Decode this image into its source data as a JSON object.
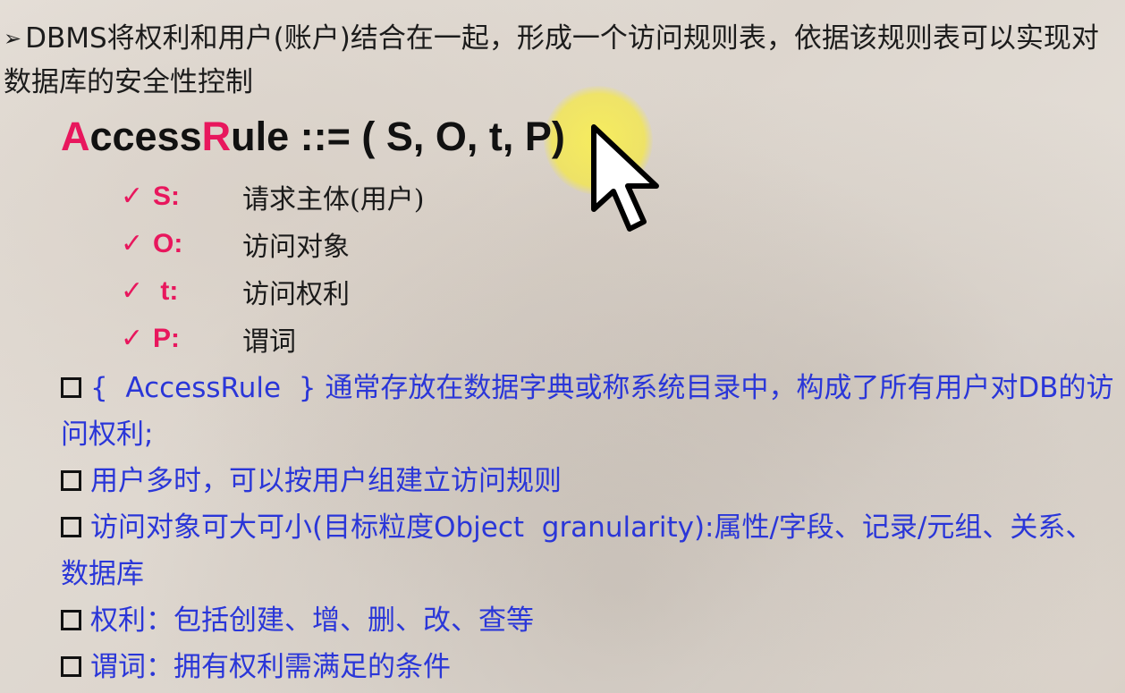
{
  "intro": {
    "arrow_glyph": "➢",
    "text": "DBMS将权利和用户(账户)结合在一起，形成一个访问规则表，依据该规则表可以实现对数据库的安全性控制"
  },
  "rule": {
    "first_letter": "A",
    "part1": "ccess",
    "second_letter": "R",
    "part2": "ule ::=  ( S, O,  t,  P)"
  },
  "definitions": [
    {
      "check": "✓",
      "key": "S:",
      "desc": "请求主体(用户)"
    },
    {
      "check": "✓",
      "key": "O:",
      "desc": "访问对象"
    },
    {
      "check": "✓",
      "key": " t:",
      "desc": "访问权利"
    },
    {
      "check": "✓",
      "key": "P:",
      "desc": "谓词"
    }
  ],
  "bullets": [
    {
      "text": "{  AccessRule  } 通常存放在数据字典或称系统目录中，构成了所有用户对DB的访问权利;"
    },
    {
      "text": "用户多时，可以按用户组建立访问规则"
    },
    {
      "text": "访问对象可大可小(目标粒度Object  granularity):属性/字段、记录/元组、关系、数据库"
    },
    {
      "text": "权利：包括创建、增、删、改、查等"
    },
    {
      "text": "谓词：拥有权利需满足的条件"
    }
  ],
  "colors": {
    "accent_red": "#e8175d",
    "bullet_blue": "#2a36d8",
    "highlight_yellow": "#f5e846"
  },
  "cursor": {
    "icon": "arrow-cursor-icon"
  }
}
